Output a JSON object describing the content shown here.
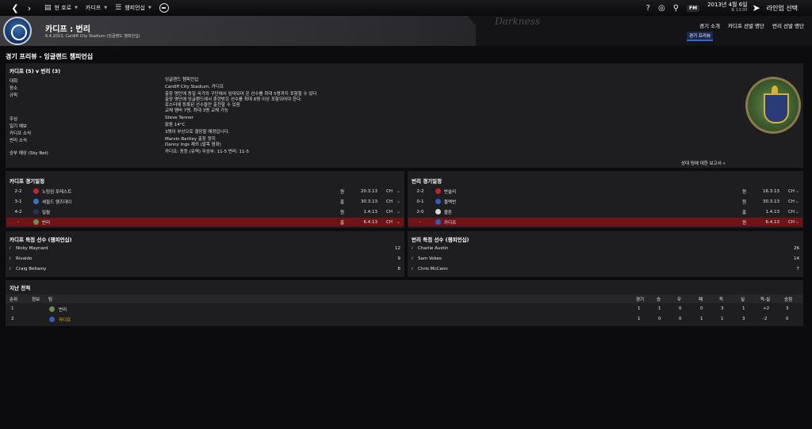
{
  "topbar": {
    "back_icon": "back-arrow-icon",
    "forward_icon": "forward-arrow-icon",
    "home_label": "현 호로",
    "club_label": "카디프",
    "competition_label": "챔피언십",
    "date_main": "2013년 4월 6일",
    "date_sub": "토 13:00",
    "fm_label": "FM",
    "continue_label": "라인업 선택"
  },
  "header": {
    "title": "카디프 : 번리",
    "subtitle": "6.4.2013, Cardiff City Stadium (잉글랜드 챔피언십)",
    "skin_logo": "Darkness",
    "tabs": [
      "경기 소개",
      "카디프 선발 명단",
      "번리 선발 명단"
    ],
    "subtab": "경기 프리뷰"
  },
  "page": {
    "title": "경기 프리뷰 - 잉글랜드 챔피언십"
  },
  "match_info": {
    "heading": "카디프 (5) v 번리 (3)",
    "rows": [
      {
        "label": "대회",
        "value": [
          "잉글랜드 챔피언십"
        ]
      },
      {
        "label": "장소",
        "value": [
          "Cardiff City Stadium, 카디프"
        ]
      },
      {
        "label": "규칙",
        "value": [
          "출장 명단에 동일 국가의 구단에서 임대되어 온 선수를 최대 5명까지 포함할 수 있다",
          "출장 명단에 잉글랜드에서 훈련받은 선수를 최대 6명 이상 포함되어야 한다.",
          "로스터에 등록된 선수들만 출전할 수 있음",
          "교체 멤버 7명, 최대 3명 교체 가능"
        ]
      },
      {
        "label": "주심",
        "value": [
          "Steve Tanner"
        ]
      },
      {
        "label": "일기 예보",
        "value": [
          "맑음 14°C"
        ]
      },
      {
        "label": "카디프 소식",
        "value": [
          "3명이 부상으로 결장할 예정입니다."
        ]
      },
      {
        "label": "번리 소식",
        "value": [
          "Marvin Bartley 출장 정지",
          "Danny Ings 제외 (발목 염좌)"
        ]
      },
      {
        "label": "승부 예상 (Sky Bet)",
        "value": [
          "카디프: 동등 (유력)  무승부: 11-5  번리: 11-5"
        ]
      }
    ],
    "report_link": "상대 팀에 대한 보고서 »"
  },
  "fixtures": {
    "cardiff": {
      "title": "카디프 경기일정",
      "rows": [
        {
          "score": "2-2",
          "opp": "노팅엄 포레스트",
          "venue": "원",
          "date": "20.3.13",
          "comp": "CH",
          "color": "#c0262b"
        },
        {
          "score": "3-1",
          "opp": "셰필드 웬즈데이",
          "venue": "홈",
          "date": "30.3.13",
          "comp": "CH",
          "color": "#3d6fc6"
        },
        {
          "score": "4-2",
          "opp": "밀월",
          "venue": "원",
          "date": "1.4.13",
          "comp": "CH",
          "color": "#22325e"
        },
        {
          "score": "-",
          "opp": "번리",
          "venue": "홈",
          "date": "6.4.13",
          "comp": "CH",
          "color": "#6d8f4e"
        }
      ]
    },
    "burnley": {
      "title": "번리 경기일정",
      "rows": [
        {
          "score": "2-2",
          "opp": "반슬리",
          "venue": "원",
          "date": "16.3.13",
          "comp": "CH",
          "color": "#c0262b"
        },
        {
          "score": "0-1",
          "opp": "블랙번",
          "venue": "원",
          "date": "30.3.13",
          "comp": "CH",
          "color": "#2e5fb8"
        },
        {
          "score": "2-0",
          "opp": "볼튼",
          "venue": "홈",
          "date": "1.4.13",
          "comp": "CH",
          "color": "#d8d8d8"
        },
        {
          "score": "-",
          "opp": "카디프",
          "venue": "원",
          "date": "6.4.13",
          "comp": "CH",
          "color": "#2e5fb8"
        }
      ]
    }
  },
  "scorers": {
    "cardiff": {
      "title": "카디프 득점 선수 (챔피언십)",
      "rows": [
        {
          "name": "Nicky Maynard",
          "goals": "12"
        },
        {
          "name": "Rivaldo",
          "goals": "9"
        },
        {
          "name": "Craig Bellamy",
          "goals": "8"
        }
      ]
    },
    "burnley": {
      "title": "번리 득점 선수 (챔피언십)",
      "rows": [
        {
          "name": "Charlie Austin",
          "goals": "26"
        },
        {
          "name": "Sam Vokes",
          "goals": "14"
        },
        {
          "name": "Chris McCann",
          "goals": "7"
        }
      ]
    }
  },
  "history": {
    "title": "지난 전적",
    "columns": [
      "순위",
      "정보",
      "팀",
      "경기",
      "승",
      "무",
      "패",
      "득",
      "실",
      "득-실",
      "승점"
    ],
    "rows": [
      {
        "pos": "1",
        "team": "번리",
        "p": "1",
        "w": "1",
        "d": "0",
        "l": "0",
        "gf": "3",
        "ga": "1",
        "gd": "+2",
        "pts": "3",
        "color": "#6d8f4e",
        "yellow": false
      },
      {
        "pos": "2",
        "team": "카디프",
        "p": "1",
        "w": "0",
        "d": "0",
        "l": "1",
        "gf": "1",
        "ga": "3",
        "gd": "-2",
        "pts": "0",
        "color": "#2e5fb8",
        "yellow": true
      }
    ]
  },
  "colors": {
    "highlight_row": "#6e1316",
    "accent": "#3a63c9",
    "yellow": "#e2c400"
  }
}
